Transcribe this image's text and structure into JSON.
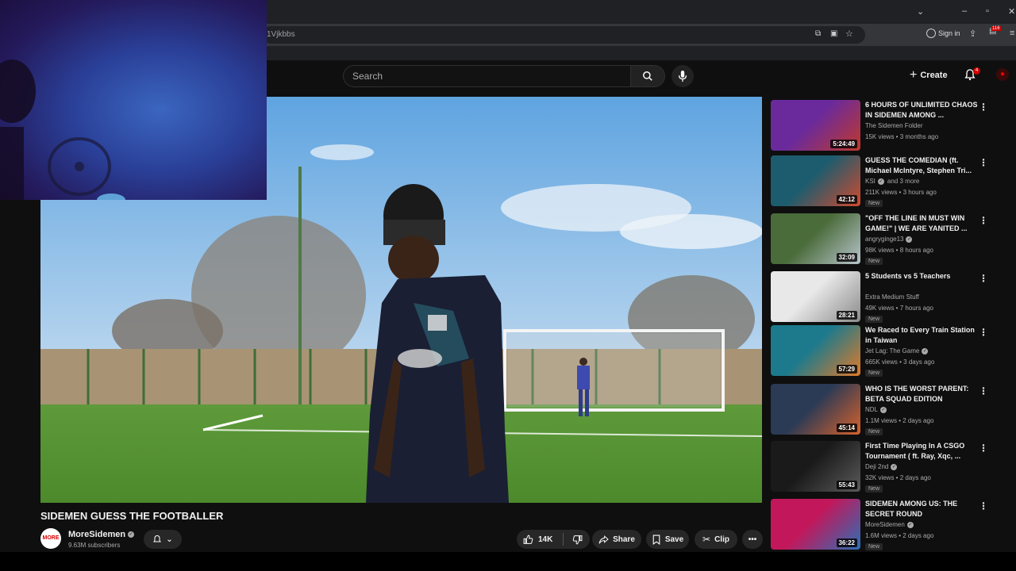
{
  "browser": {
    "url_fragment": "1Vjkbbs",
    "sign_in_label": "Sign in",
    "extension_badge": "116"
  },
  "header": {
    "search_placeholder": "Search",
    "create_label": "Create",
    "notification_count": "4"
  },
  "video": {
    "title": "SIDEMEN GUESS THE FOOTBALLER",
    "channel_name": "MoreSidemen",
    "subscribers": "9.63M subscribers",
    "likes": "14K",
    "share_label": "Share",
    "save_label": "Save",
    "clip_label": "Clip"
  },
  "recommendations": [
    {
      "title": "6 HOURS OF UNLIMITED CHAOS IN SIDEMEN AMONG ...",
      "channel": "The Sidemen Folder",
      "verified": false,
      "meta": "15K views • 3 months ago",
      "badge": "",
      "duration": "5:24:49",
      "thumb_color": "#6a2a9c",
      "thumb_color2": "#c0392b"
    },
    {
      "title": "GUESS THE COMEDIAN (ft. Michael McIntyre, Stephen Tri...",
      "channel": "KSI",
      "channel_extra": "and 3 more",
      "verified": true,
      "meta": "211K views • 3 hours ago",
      "badge": "New",
      "duration": "42:12",
      "thumb_color": "#1d5c6e",
      "thumb_color2": "#d14a2e"
    },
    {
      "title": "\"OFF THE LINE IN MUST WIN GAME!\" | WE ARE YANITED ...",
      "channel": "angryginge13",
      "verified": true,
      "meta": "98K views • 8 hours ago",
      "badge": "New",
      "duration": "32:09",
      "thumb_color": "#4a6b3a",
      "thumb_color2": "#b8c4cc"
    },
    {
      "title": "5 Students vs 5 Teachers",
      "channel": "Extra Medium Stuff",
      "verified": false,
      "meta": "49K views • 7 hours ago",
      "badge": "New",
      "duration": "28:21",
      "thumb_color": "#e8e8e8",
      "thumb_color2": "#8a8a8a"
    },
    {
      "title": "We Raced to Every Train Station in Taiwan",
      "channel": "Jet Lag: The Game",
      "verified": true,
      "meta": "665K views • 3 days ago",
      "badge": "New",
      "duration": "57:29",
      "thumb_color": "#1c7a8c",
      "thumb_color2": "#e07a2a"
    },
    {
      "title": "WHO IS THE WORST PARENT: BETA SQUAD EDITION",
      "channel": "NDL",
      "verified": true,
      "meta": "1.1M views • 2 days ago",
      "badge": "New",
      "duration": "45:14",
      "thumb_color": "#2b3a55",
      "thumb_color2": "#d9622b"
    },
    {
      "title": "First Time Playing In A CSGO Tournament ( ft. Ray, Xqc, ...",
      "channel": "Deji 2nd",
      "verified": true,
      "meta": "32K views • 2 days ago",
      "badge": "New",
      "duration": "55:43",
      "thumb_color": "#1a1a1a",
      "thumb_color2": "#5a5a5a"
    },
    {
      "title": "SIDEMEN AMONG US: THE SECRET ROUND",
      "channel": "MoreSidemen",
      "verified": true,
      "meta": "1.6M views • 2 days ago",
      "badge": "New",
      "duration": "36:22",
      "thumb_color": "#c2185b",
      "thumb_color2": "#2c6fb5"
    }
  ],
  "colors": {
    "background": "#0f0f0f",
    "accent_red": "#cc0000",
    "pill": "#272727"
  }
}
